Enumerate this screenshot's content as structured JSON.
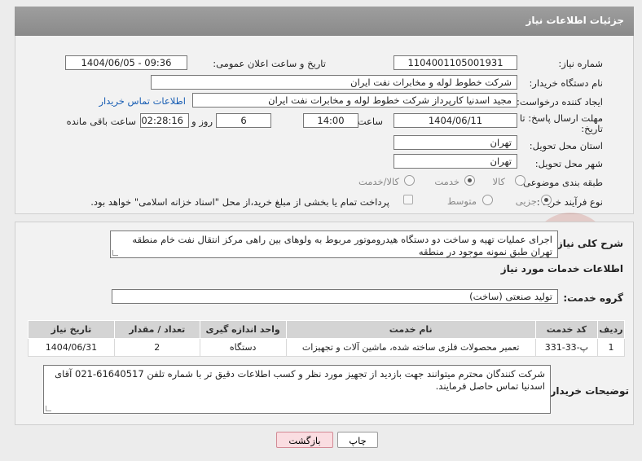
{
  "header": {
    "title": "جزئیات اطلاعات نیاز"
  },
  "need_number": {
    "label": "شماره نیاز:",
    "value": "1104001105001931"
  },
  "announce": {
    "label": "تاریخ و ساعت اعلان عمومی:",
    "value": "1404/06/05 - 09:36"
  },
  "buyer": {
    "label": "نام دستگاه خریدار:",
    "value": "شرکت خطوط لوله و مخابرات نفت ایران"
  },
  "creator": {
    "label": "ایجاد کننده درخواست:",
    "value": "مجید اسدنیا  کارپرداز شرکت خطوط لوله و مخابرات نفت ایران",
    "contact_link": "اطلاعات تماس خریدار"
  },
  "deadline": {
    "label_line1": "مهلت ارسال پاسخ: تا",
    "label_line2": "تاریخ:",
    "date": "1404/06/11",
    "time_label": "ساعت",
    "time": "14:00",
    "days": "6",
    "days_label": "روز و",
    "remaining": "02:28:16",
    "remaining_label": "ساعت باقی مانده"
  },
  "province": {
    "label": "استان محل تحویل:",
    "value": "تهران"
  },
  "city": {
    "label": "شهر محل تحویل:",
    "value": "تهران"
  },
  "category": {
    "label": "طبقه بندی موضوعی:",
    "options": [
      "کالا",
      "خدمت",
      "کالا/خدمت"
    ],
    "selected": "خدمت"
  },
  "process": {
    "label": "نوع فرآیند خرید :",
    "options": [
      "جزیی",
      "متوسط"
    ],
    "selected": "جزیی",
    "payment_note": "پرداخت تمام یا بخشی از مبلغ خرید،از محل \"اسناد خزانه اسلامی\" خواهد بود."
  },
  "description": {
    "label": "شرح کلی نیاز:",
    "value": "اجرای عملیات تهیه و ساخت دو دستگاه هیدروموتور مربوط به ولوهای بین راهی مرکز انتقال نفت خام منطقه تهران طبق نمونه موجود در منطقه"
  },
  "services_section": {
    "title": "اطلاعات خدمات مورد نیاز"
  },
  "service_group": {
    "label": "گروه خدمت:",
    "value": "تولید صنعتی (ساخت)"
  },
  "table": {
    "headers": [
      "ردیف",
      "کد خدمت",
      "نام خدمت",
      "واحد اندازه گیری",
      "تعداد / مقدار",
      "تاریخ نیاز"
    ],
    "rows": [
      [
        "1",
        "پ-33-331",
        "تعمیر محصولات فلزی ساخته شده، ماشین آلات و تجهیزات",
        "دستگاه",
        "2",
        "1404/06/31"
      ]
    ]
  },
  "buyer_notes": {
    "label": "توضیحات خریدار:",
    "value": "شرکت کنندگان محترم میتوانند جهت بازدید از تجهیز مورد نظر و کسب اطلاعات دقیق تر با شماره تلفن 61640517-021 آقای اسدنیا تماس حاصل فرمایند."
  },
  "buttons": {
    "print": "چاپ",
    "back": "بازگشت"
  },
  "watermark": {
    "text": "AriaTender.neT"
  },
  "colors": {
    "header_bg": "#999999",
    "link": "#1a5fb4",
    "back_button": "#fadde1",
    "watermark": "#c0392b"
  }
}
